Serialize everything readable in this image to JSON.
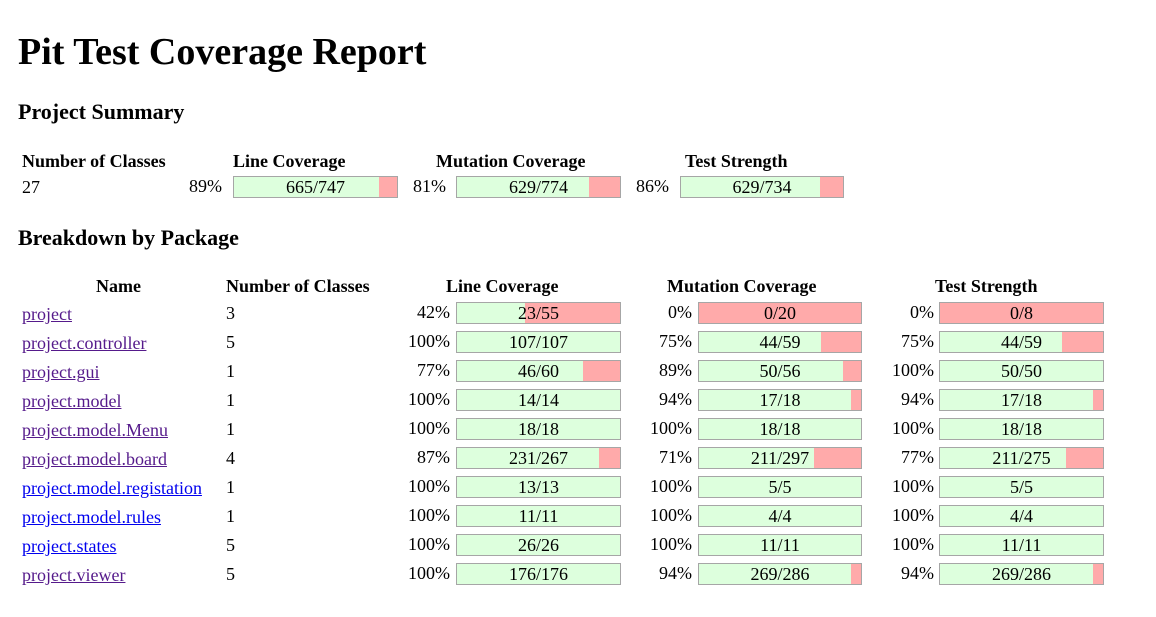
{
  "title": "Pit Test Coverage Report",
  "summary": {
    "heading": "Project Summary",
    "headers": [
      "Number of Classes",
      "Line Coverage",
      "Mutation Coverage",
      "Test Strength"
    ],
    "classes": "27",
    "line": {
      "pct": "89%",
      "text": "665/747",
      "ratio": 0.89
    },
    "mutation": {
      "pct": "81%",
      "text": "629/774",
      "ratio": 0.81
    },
    "strength": {
      "pct": "86%",
      "text": "629/734",
      "ratio": 0.86
    }
  },
  "breakdown": {
    "heading": "Breakdown by Package",
    "headers": [
      "Name",
      "Number of Classes",
      "Line Coverage",
      "Mutation Coverage",
      "Test Strength"
    ],
    "rows": [
      {
        "name": "project",
        "classes": "3",
        "visited": true,
        "line": {
          "pct": "42%",
          "text": "23/55",
          "ratio": 0.42
        },
        "mutation": {
          "pct": "0%",
          "text": "0/20",
          "ratio": 0
        },
        "strength": {
          "pct": "0%",
          "text": "0/8",
          "ratio": 0
        }
      },
      {
        "name": "project.controller",
        "classes": "5",
        "visited": true,
        "line": {
          "pct": "100%",
          "text": "107/107",
          "ratio": 1
        },
        "mutation": {
          "pct": "75%",
          "text": "44/59",
          "ratio": 0.75
        },
        "strength": {
          "pct": "75%",
          "text": "44/59",
          "ratio": 0.75
        }
      },
      {
        "name": "project.gui",
        "classes": "1",
        "visited": true,
        "line": {
          "pct": "77%",
          "text": "46/60",
          "ratio": 0.77
        },
        "mutation": {
          "pct": "89%",
          "text": "50/56",
          "ratio": 0.89
        },
        "strength": {
          "pct": "100%",
          "text": "50/50",
          "ratio": 1
        }
      },
      {
        "name": "project.model",
        "classes": "1",
        "visited": true,
        "line": {
          "pct": "100%",
          "text": "14/14",
          "ratio": 1
        },
        "mutation": {
          "pct": "94%",
          "text": "17/18",
          "ratio": 0.94
        },
        "strength": {
          "pct": "94%",
          "text": "17/18",
          "ratio": 0.94
        }
      },
      {
        "name": "project.model.Menu",
        "classes": "1",
        "visited": true,
        "line": {
          "pct": "100%",
          "text": "18/18",
          "ratio": 1
        },
        "mutation": {
          "pct": "100%",
          "text": "18/18",
          "ratio": 1
        },
        "strength": {
          "pct": "100%",
          "text": "18/18",
          "ratio": 1
        }
      },
      {
        "name": "project.model.board",
        "classes": "4",
        "visited": true,
        "line": {
          "pct": "87%",
          "text": "231/267",
          "ratio": 0.87
        },
        "mutation": {
          "pct": "71%",
          "text": "211/297",
          "ratio": 0.71
        },
        "strength": {
          "pct": "77%",
          "text": "211/275",
          "ratio": 0.77
        }
      },
      {
        "name": "project.model.registation",
        "classes": "1",
        "visited": false,
        "line": {
          "pct": "100%",
          "text": "13/13",
          "ratio": 1
        },
        "mutation": {
          "pct": "100%",
          "text": "5/5",
          "ratio": 1
        },
        "strength": {
          "pct": "100%",
          "text": "5/5",
          "ratio": 1
        }
      },
      {
        "name": "project.model.rules",
        "classes": "1",
        "visited": false,
        "line": {
          "pct": "100%",
          "text": "11/11",
          "ratio": 1
        },
        "mutation": {
          "pct": "100%",
          "text": "4/4",
          "ratio": 1
        },
        "strength": {
          "pct": "100%",
          "text": "4/4",
          "ratio": 1
        }
      },
      {
        "name": "project.states",
        "classes": "5",
        "visited": false,
        "line": {
          "pct": "100%",
          "text": "26/26",
          "ratio": 1
        },
        "mutation": {
          "pct": "100%",
          "text": "11/11",
          "ratio": 1
        },
        "strength": {
          "pct": "100%",
          "text": "11/11",
          "ratio": 1
        }
      },
      {
        "name": "project.viewer",
        "classes": "5",
        "visited": true,
        "line": {
          "pct": "100%",
          "text": "176/176",
          "ratio": 1
        },
        "mutation": {
          "pct": "94%",
          "text": "269/286",
          "ratio": 0.94
        },
        "strength": {
          "pct": "94%",
          "text": "269/286",
          "ratio": 0.94
        }
      }
    ]
  },
  "colors": {
    "covered": "#ddffdd",
    "uncovered": "#ffaaaa",
    "link": "#0000ee",
    "visited_link": "#551a8b"
  }
}
